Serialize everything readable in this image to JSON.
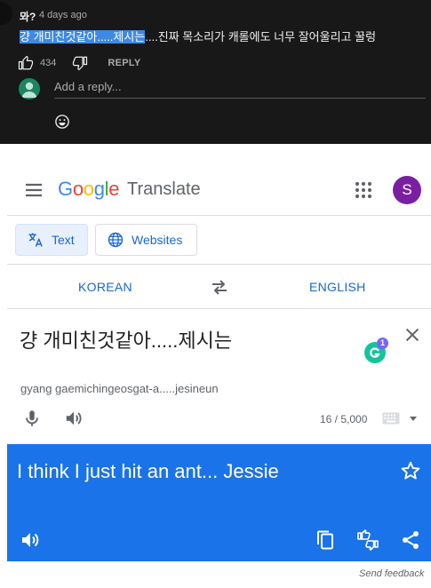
{
  "youtube": {
    "author": "뫄?",
    "time": "4 days ago",
    "comment_highlight": "걍 개미친것같아.....제시는",
    "comment_rest": "....진짜 목소리가 캐롤에도 너무 잘어울리고 꿀렁",
    "like_count": "434",
    "reply_label": "REPLY",
    "reply_placeholder": "Add a reply...",
    "icons": [
      "thumb-up-icon",
      "thumb-down-icon",
      "avatar-icon",
      "emoji-icon"
    ]
  },
  "translate": {
    "logo_letters": [
      {
        "char": "G",
        "color": "#4285F4"
      },
      {
        "char": "o",
        "color": "#EA4335"
      },
      {
        "char": "o",
        "color": "#FBBC05"
      },
      {
        "char": "g",
        "color": "#4285F4"
      },
      {
        "char": "l",
        "color": "#34A853"
      },
      {
        "char": "e",
        "color": "#EA4335"
      }
    ],
    "product_name": "Translate",
    "account_initial": "S",
    "modes": {
      "text_label": "Text",
      "websites_label": "Websites"
    },
    "source_lang": "KOREAN",
    "target_lang": "ENGLISH",
    "source_text": "걍 개미친것같아.....제시는",
    "romanization": "gyang gaemichingeosgat-a.....jesineun",
    "char_count": "16 / 5,000",
    "grammarly_badge": "1",
    "target_text": "I think I just hit an ant... Jessie",
    "feedback_label": "Send feedback",
    "colors": {
      "accent_blue": "#1a73e8",
      "link_blue": "#1967d2",
      "account_purple": "#7b1fa2",
      "youtube_bg": "#181818",
      "highlight": "#3e89e4"
    }
  }
}
